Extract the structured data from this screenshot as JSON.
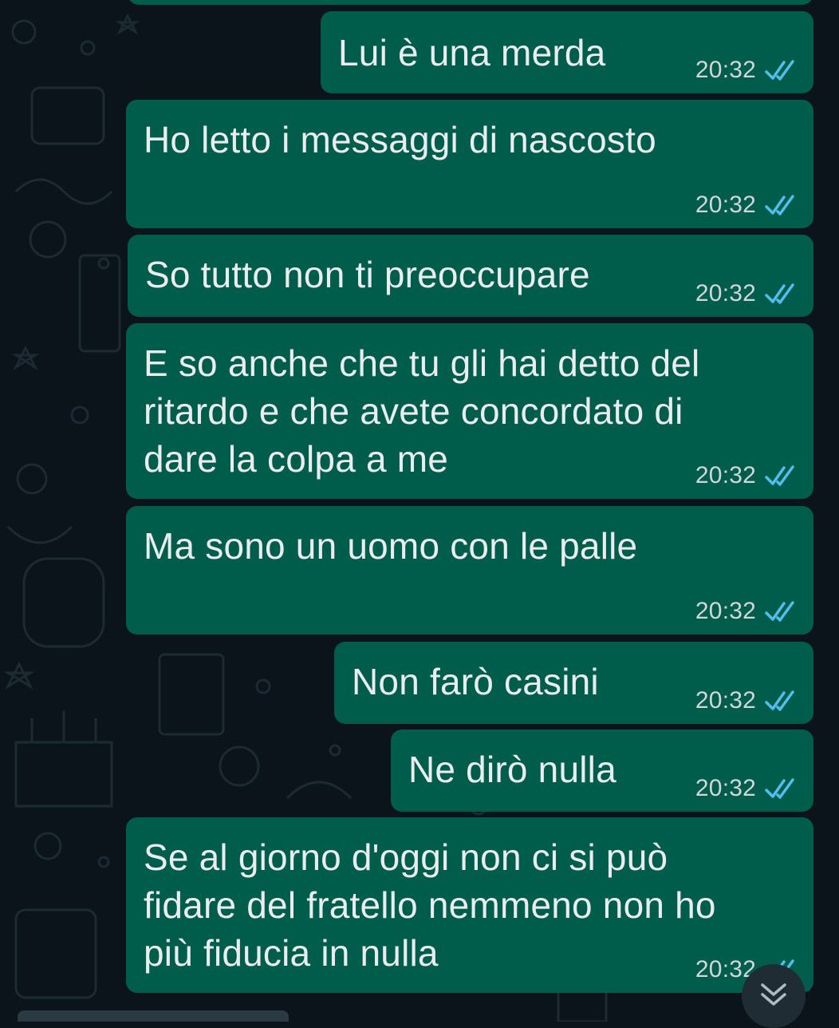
{
  "messages": [
    {
      "text": "Lui è una merda",
      "time": "20:32",
      "status": "read"
    },
    {
      "text": "Ho letto i messaggi di nascosto",
      "time": "20:32",
      "status": "read"
    },
    {
      "text": "So tutto non ti preoccupare",
      "time": "20:32",
      "status": "read"
    },
    {
      "text": "E so anche che tu gli hai detto del\nritardo e che avete concordato di\ndare la colpa a me",
      "time": "20:32",
      "status": "read"
    },
    {
      "text": "Ma sono un uomo con le palle",
      "time": "20:32",
      "status": "read"
    },
    {
      "text": "Non farò casini",
      "time": "20:32",
      "status": "read"
    },
    {
      "text": "Ne dirò nulla",
      "time": "20:32",
      "status": "read"
    },
    {
      "text": "Se al giorno d'oggi non ci si può\nfidare del fratello nemmeno non ho\npiù fiducia in nulla",
      "time": "20:32",
      "status": "read"
    }
  ],
  "colors": {
    "background": "#0b141a",
    "outgoing_bubble": "#005c4b",
    "read_tick": "#53bdeb"
  },
  "icons": {
    "read_receipt": "double-check-icon",
    "scroll_down": "double-chevron-down-icon"
  }
}
